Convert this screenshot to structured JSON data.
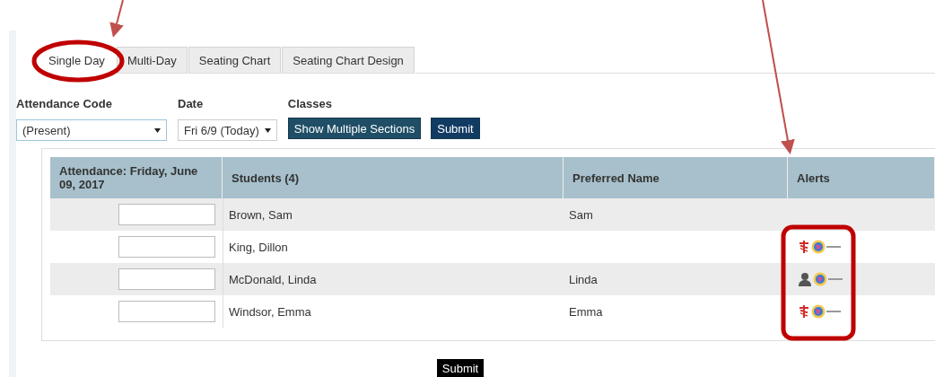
{
  "tabs": [
    {
      "label": "Single Day",
      "selected": true
    },
    {
      "label": "Multi-Day",
      "selected": false
    },
    {
      "label": "Seating Chart",
      "selected": false
    },
    {
      "label": "Seating Chart Design",
      "selected": false
    }
  ],
  "filters": {
    "attendance_code": {
      "label": "Attendance Code",
      "value": "(Present)"
    },
    "date": {
      "label": "Date",
      "value": "Fri 6/9 (Today)"
    },
    "classes": {
      "label": "Classes",
      "button": "Show Multiple Sections"
    },
    "submit": "Submit"
  },
  "table": {
    "columns": [
      "Attendance: Friday, June 09, 2017",
      "Students (4)",
      "Preferred Name",
      "Alerts"
    ],
    "rows": [
      {
        "student": "Brown, Sam",
        "preferred_name": "Sam",
        "alerts": []
      },
      {
        "student": "King, Dillon",
        "alerts": [
          {
            "kind": "medical"
          },
          {
            "kind": "logo"
          }
        ]
      },
      {
        "student": "McDonald, Linda",
        "preferred_name": "Linda",
        "alerts": [
          {
            "kind": "person"
          },
          {
            "kind": "logo"
          }
        ]
      },
      {
        "student": "Windsor, Emma",
        "preferred_name": "Emma",
        "alerts": [
          {
            "kind": "medical"
          },
          {
            "kind": "logo"
          }
        ]
      }
    ]
  },
  "submit": "Submit"
}
